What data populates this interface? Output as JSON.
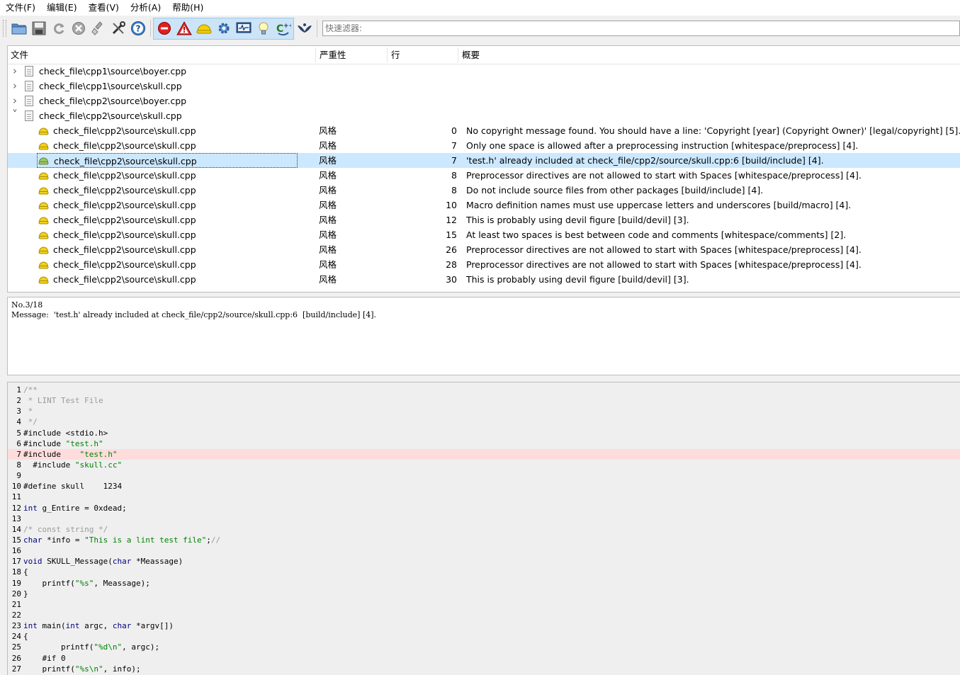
{
  "menu": [
    "文件(F)",
    "编辑(E)",
    "查看(V)",
    "分析(A)",
    "帮助(H)"
  ],
  "toolbar": {
    "buttons": [
      "open-folder-icon",
      "save-icon",
      "reload-icon",
      "stop-icon",
      "clear-icon",
      "tools-icon",
      "help-icon",
      "error-filter-icon",
      "warning-filter-icon",
      "style-filter-icon",
      "performance-filter-icon",
      "portability-filter-icon",
      "information-filter-icon",
      "cpp-standard-icon",
      "library-icon"
    ],
    "filter_placeholder": "快速滤器:"
  },
  "results": {
    "columns": [
      "文件",
      "严重性",
      "行",
      "概要"
    ],
    "files": [
      {
        "name": "check_file\\cpp1\\source\\boyer.cpp",
        "expanded": false
      },
      {
        "name": "check_file\\cpp1\\source\\skull.cpp",
        "expanded": false
      },
      {
        "name": "check_file\\cpp2\\source\\boyer.cpp",
        "expanded": false
      },
      {
        "name": "check_file\\cpp2\\source\\skull.cpp",
        "expanded": true
      }
    ],
    "items": [
      {
        "file": "check_file\\cpp2\\source\\skull.cpp",
        "severity": "风格",
        "line": "0",
        "summary": "No copyright message found.  You should have a line: 'Copyright [year] (Copyright Owner)'  [legal/copyright] [5]."
      },
      {
        "file": "check_file\\cpp2\\source\\skull.cpp",
        "severity": "风格",
        "line": "7",
        "summary": "Only one space is allowed after a preprocessing instruction  [whitespace/preprocess] [4]."
      },
      {
        "file": "check_file\\cpp2\\source\\skull.cpp",
        "severity": "风格",
        "line": "7",
        "summary": "'test.h' already included at check_file/cpp2/source/skull.cpp:6  [build/include] [4].",
        "selected": true
      },
      {
        "file": "check_file\\cpp2\\source\\skull.cpp",
        "severity": "风格",
        "line": "8",
        "summary": "Preprocessor directives are not allowed to start with Spaces  [whitespace/preprocess] [4]."
      },
      {
        "file": "check_file\\cpp2\\source\\skull.cpp",
        "severity": "风格",
        "line": "8",
        "summary": "Do not include source files from other packages  [build/include] [4]."
      },
      {
        "file": "check_file\\cpp2\\source\\skull.cpp",
        "severity": "风格",
        "line": "10",
        "summary": "Macro definition names must use uppercase letters and underscores  [build/macro] [4]."
      },
      {
        "file": "check_file\\cpp2\\source\\skull.cpp",
        "severity": "风格",
        "line": "12",
        "summary": "This is probably using devil figure  [build/devil] [3]."
      },
      {
        "file": "check_file\\cpp2\\source\\skull.cpp",
        "severity": "风格",
        "line": "15",
        "summary": "At least two spaces is best between code and comments  [whitespace/comments] [2]."
      },
      {
        "file": "check_file\\cpp2\\source\\skull.cpp",
        "severity": "风格",
        "line": "26",
        "summary": "Preprocessor directives are not allowed to start with Spaces  [whitespace/preprocess] [4]."
      },
      {
        "file": "check_file\\cpp2\\source\\skull.cpp",
        "severity": "风格",
        "line": "28",
        "summary": "Preprocessor directives are not allowed to start with Spaces  [whitespace/preprocess] [4]."
      },
      {
        "file": "check_file\\cpp2\\source\\skull.cpp",
        "severity": "风格",
        "line": "30",
        "summary": "This is probably using devil figure  [build/devil] [3]."
      }
    ]
  },
  "message": {
    "line1": "No.3/18",
    "line2": "Message:  'test.h' already included at check_file/cpp2/source/skull.cpp:6  [build/include] [4]."
  },
  "code": {
    "highlight_line": 7,
    "lines": [
      [
        {
          "t": "/**",
          "c": "cmt"
        }
      ],
      [
        {
          "t": " * LINT Test File",
          "c": "cmt"
        }
      ],
      [
        {
          "t": " *",
          "c": "cmt"
        }
      ],
      [
        {
          "t": " */",
          "c": "cmt"
        }
      ],
      [
        {
          "t": "#include <stdio.h>",
          "c": ""
        }
      ],
      [
        {
          "t": "#include ",
          "c": ""
        },
        {
          "t": "\"test.h\"",
          "c": "str"
        }
      ],
      [
        {
          "t": "#include    ",
          "c": ""
        },
        {
          "t": "\"test.h\"",
          "c": "str"
        }
      ],
      [
        {
          "t": "  #include ",
          "c": ""
        },
        {
          "t": "\"skull.cc\"",
          "c": "str"
        }
      ],
      [],
      [
        {
          "t": "#define skull    1234",
          "c": ""
        }
      ],
      [],
      [
        {
          "t": "int",
          "c": "kw"
        },
        {
          "t": " g_Entire = 0xdead;",
          "c": ""
        }
      ],
      [],
      [
        {
          "t": "/* const string */",
          "c": "cmt"
        }
      ],
      [
        {
          "t": "char",
          "c": "kw"
        },
        {
          "t": " *info = ",
          "c": ""
        },
        {
          "t": "\"This is a lint test file\"",
          "c": "str"
        },
        {
          "t": ";",
          "c": ""
        },
        {
          "t": "//",
          "c": "cmt"
        }
      ],
      [],
      [
        {
          "t": "void",
          "c": "kw"
        },
        {
          "t": " SKULL_Message(",
          "c": ""
        },
        {
          "t": "char",
          "c": "kw"
        },
        {
          "t": " *Meassage)",
          "c": ""
        }
      ],
      [
        {
          "t": "{",
          "c": ""
        }
      ],
      [
        {
          "t": "    printf(",
          "c": ""
        },
        {
          "t": "\"%s\"",
          "c": "str"
        },
        {
          "t": ", Meassage);",
          "c": ""
        }
      ],
      [
        {
          "t": "}",
          "c": ""
        }
      ],
      [],
      [],
      [
        {
          "t": "int",
          "c": "kw"
        },
        {
          "t": " main(",
          "c": ""
        },
        {
          "t": "int",
          "c": "kw"
        },
        {
          "t": " argc, ",
          "c": ""
        },
        {
          "t": "char",
          "c": "kw"
        },
        {
          "t": " *argv[])",
          "c": ""
        }
      ],
      [
        {
          "t": "{",
          "c": ""
        }
      ],
      [
        {
          "t": "        printf(",
          "c": ""
        },
        {
          "t": "\"%d\\n\"",
          "c": "str"
        },
        {
          "t": ", argc);",
          "c": ""
        }
      ],
      [
        {
          "t": "    #if 0",
          "c": ""
        }
      ],
      [
        {
          "t": "    printf(",
          "c": ""
        },
        {
          "t": "\"%s\\n\"",
          "c": "str"
        },
        {
          "t": ", info);",
          "c": ""
        }
      ]
    ]
  }
}
